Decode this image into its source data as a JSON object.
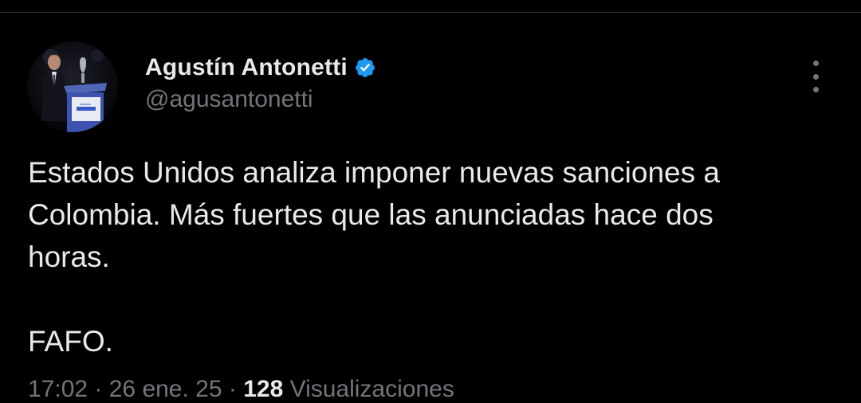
{
  "tweet": {
    "author": {
      "display_name": "Agustín Antonetti",
      "handle": "@agusantonetti",
      "verified": true,
      "avatar_icon": "profile-photo-speaker-at-podium"
    },
    "body_text": "Estados Unidos analiza imponer nuevas sanciones a\nColombia. Más fuertes que las anunciadas hace dos\nhoras.\n\nFAFO.",
    "meta": {
      "time_date": "17:02 · 26 ene. 25 · ",
      "views_count": "128",
      "views_label": " Visualizaciones"
    },
    "more_icon": "more-vertical-icon"
  },
  "colors": {
    "background": "#000000",
    "text_primary": "#e7e9ea",
    "text_secondary": "#71767b",
    "verified_blue": "#1d9bf0",
    "divider": "#2f3336"
  }
}
